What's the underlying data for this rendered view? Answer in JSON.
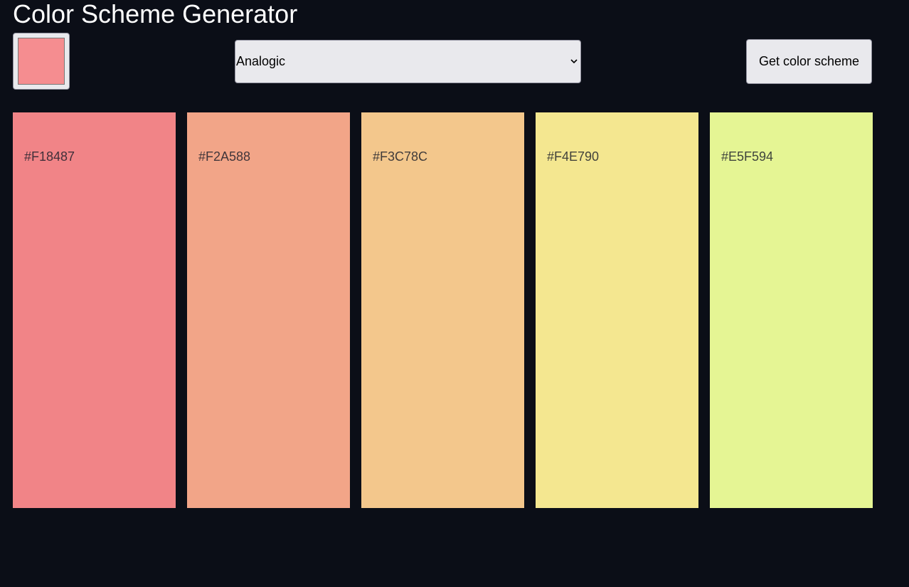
{
  "title": "Color Scheme Generator",
  "color_picker": {
    "value": "#F18487",
    "display_color": "#f58d90"
  },
  "mode_select": {
    "selected": "Analogic"
  },
  "get_button": {
    "label": "Get color scheme"
  },
  "colors": [
    {
      "hex": "#F18487",
      "color": "#f18487"
    },
    {
      "hex": "#F2A588",
      "color": "#f2a588"
    },
    {
      "hex": "#F3C78C",
      "color": "#f3c78c"
    },
    {
      "hex": "#F4E790",
      "color": "#f4e790"
    },
    {
      "hex": "#E5F594",
      "color": "#e5f594"
    }
  ],
  "theme": {
    "background": "#0b0e17",
    "control_background": "#e9e9ed"
  }
}
